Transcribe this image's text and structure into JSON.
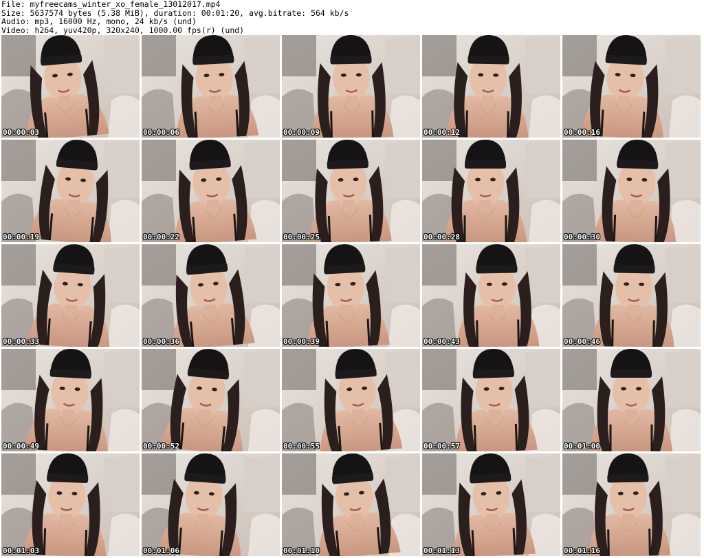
{
  "header": {
    "file_line": "File: myfreecams_winter_xo_female_13012017.mp4",
    "size_line": "Size: 5637574 bytes (5.38 MiB), duration: 00:01:20, avg.bitrate: 564 kb/s",
    "audio_line": "Audio: mp3, 16000 Hz, mono, 24 kb/s (und)",
    "video_line": "Video: h264, yuv420p, 320x240, 1000.00 fps(r) (und)"
  },
  "thumbnails": [
    {
      "timestamp": "00:00:03"
    },
    {
      "timestamp": "00:00:06"
    },
    {
      "timestamp": "00:00:09"
    },
    {
      "timestamp": "00:00:12"
    },
    {
      "timestamp": "00:00:16"
    },
    {
      "timestamp": "00:00:19"
    },
    {
      "timestamp": "00:00:22"
    },
    {
      "timestamp": "00:00:25"
    },
    {
      "timestamp": "00:00:28"
    },
    {
      "timestamp": "00:00:30"
    },
    {
      "timestamp": "00:00:33"
    },
    {
      "timestamp": "00:00:36"
    },
    {
      "timestamp": "00:00:39"
    },
    {
      "timestamp": "00:00:43"
    },
    {
      "timestamp": "00:00:46"
    },
    {
      "timestamp": "00:00:49"
    },
    {
      "timestamp": "00:00:52"
    },
    {
      "timestamp": "00:00:55"
    },
    {
      "timestamp": "00:00:57"
    },
    {
      "timestamp": "00:01:00"
    },
    {
      "timestamp": "00:01:03"
    },
    {
      "timestamp": "00:01:06"
    },
    {
      "timestamp": "00:01:10"
    },
    {
      "timestamp": "00:01:13"
    },
    {
      "timestamp": "00:01:16"
    }
  ],
  "colors": {
    "background": "#ffffff",
    "text": "#000000",
    "timestamp_text": "#ffffff",
    "timestamp_outline": "#000000"
  }
}
